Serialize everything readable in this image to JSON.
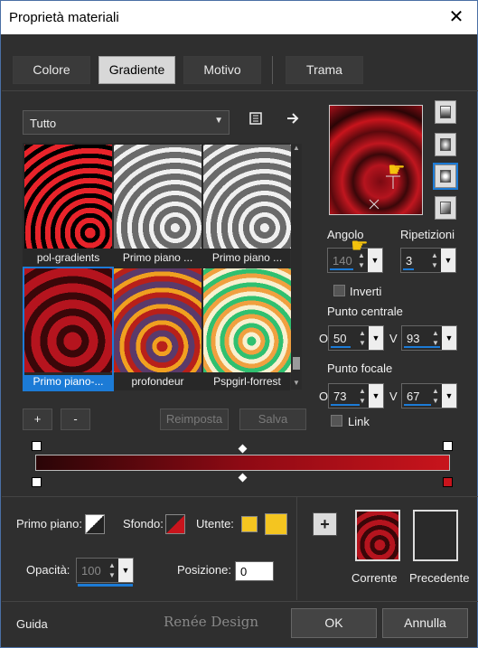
{
  "window": {
    "title": "Proprietà materiali",
    "close": "✕"
  },
  "tabs": [
    "Colore",
    "Gradiente",
    "Motivo",
    "Trama"
  ],
  "library": {
    "category": "Tutto",
    "items": [
      {
        "label": "pol-gradients"
      },
      {
        "label": "Primo piano ..."
      },
      {
        "label": "Primo piano ..."
      },
      {
        "label": "Primo piano-..."
      },
      {
        "label": "profondeur"
      },
      {
        "label": "Pspgirl-forrest"
      }
    ],
    "add_label": "+",
    "remove_label": "-",
    "reset_label": "Reimposta",
    "save_label": "Salva"
  },
  "angle": {
    "label": "Angolo",
    "value": "140"
  },
  "repeats": {
    "label": "Ripetizioni",
    "value": "3"
  },
  "invert": {
    "label": "Inverti",
    "checked": false
  },
  "center": {
    "label": "Punto centrale",
    "o_label": "O",
    "o_value": "50",
    "v_label": "V",
    "v_value": "93"
  },
  "focal": {
    "label": "Punto focale",
    "o_label": "O",
    "o_value": "73",
    "v_label": "V",
    "v_value": "67"
  },
  "link": {
    "label": "Link",
    "checked": false
  },
  "bottom": {
    "foreground_label": "Primo piano:",
    "background_label": "Sfondo:",
    "user_label": "Utente:",
    "opacity_label": "Opacità:",
    "opacity_value": "100",
    "position_label": "Posizione:",
    "position_value": "0",
    "current_label": "Corrente",
    "previous_label": "Precedente",
    "plus": "+"
  },
  "footer": {
    "help": "Guida",
    "ok": "OK",
    "cancel": "Annulla",
    "watermark": "Renée Design"
  },
  "colors": {
    "accent": "#1c7bd6",
    "user_swatch": "#f4c520",
    "red": "#c8141c"
  }
}
